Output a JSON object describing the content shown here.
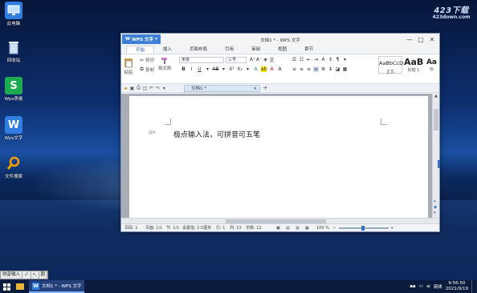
{
  "desktop": {
    "icons": [
      {
        "label": "此电脑",
        "icon": "computer-icon",
        "color": "#2f7de1"
      },
      {
        "label": "回收站",
        "icon": "recycle-bin-icon",
        "color": "#9fb7d8"
      },
      {
        "label": "Wps表格",
        "icon": "wps-sheets-icon",
        "color": "#1dab52"
      },
      {
        "label": "Wps文字",
        "icon": "wps-writer-icon",
        "color": "#2f7de1"
      },
      {
        "label": "文件搜索",
        "icon": "search-icon",
        "color": "#f4a000"
      }
    ],
    "watermark": {
      "line1": "423下载",
      "line2": "423down.com"
    }
  },
  "window": {
    "app_button": "WPS 文字",
    "title": "文档1 * - WPS 文字",
    "tabs": [
      "开始",
      "插入",
      "页面布局",
      "引用",
      "审阅",
      "视图",
      "章节"
    ],
    "active_tab": "开始",
    "ribbon": {
      "paste": "粘贴",
      "cut": "剪切",
      "copy": "复制",
      "format_painter": "格式刷",
      "font_name": "宋体",
      "font_size": "三号",
      "styles": [
        {
          "preview": "AaBbCcD",
          "name": "正文"
        },
        {
          "preview": "AaB",
          "name": "标题 1"
        },
        {
          "preview": "Aa",
          "name": "标"
        }
      ]
    },
    "doc_tab": "文档1 *",
    "document": {
      "text": "极点输入法，可拼音可五笔"
    },
    "statusbar": {
      "page_no": "页码: 1",
      "page": "页面: 1/1",
      "section": "节: 1/1",
      "setting": "设置值: 2.5厘米",
      "row": "行: 1",
      "col": "列: 13",
      "words": "字数: 12",
      "zoom": "100 %"
    }
  },
  "taskbar": {
    "ime": [
      "拼音输入",
      "ノ",
      "•,",
      "囲"
    ],
    "item": "文档1 * - WPS 文字",
    "lang": "简体",
    "time": "9:56:50",
    "date": "2021/9/19"
  }
}
